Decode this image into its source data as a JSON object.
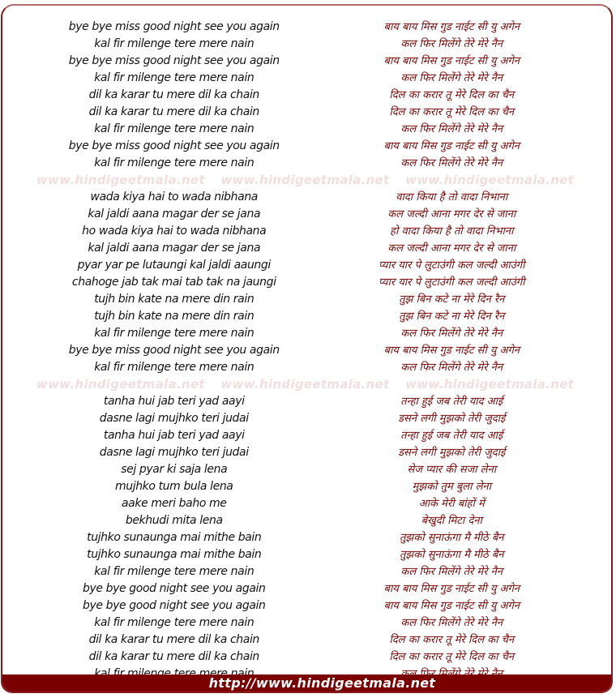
{
  "watermark_text": "www.hindigeetmala.net",
  "footer": {
    "url_text": "http://www.hindigeetmala.net"
  },
  "colors": {
    "accent": "#7a0000",
    "english_text": "#111111",
    "hindi_text": "#7a0a0a",
    "watermark": "#f1dede"
  },
  "stanzas": [
    {
      "lines": [
        {
          "en": "bye bye miss good night see you again",
          "hi": "बाय बाय मिस गुड नाईट सी यु अगेन"
        },
        {
          "en": "kal fir milenge tere mere nain",
          "hi": "कल फिर मिलेंगे तेरे मेरे नैन"
        },
        {
          "en": "bye bye miss good night see you again",
          "hi": "बाय बाय मिस गुड नाईट सी यु अगेन"
        },
        {
          "en": "kal fir milenge tere mere nain",
          "hi": "कल फिर मिलेंगे तेरे मेरे नैन"
        },
        {
          "en": "dil ka karar tu mere dil ka chain",
          "hi": "दिल का करार तू मेरे दिल का चैन"
        },
        {
          "en": "dil ka karar tu mere dil ka chain",
          "hi": "दिल का करार तू मेरे दिल का चैन"
        },
        {
          "en": "kal fir milenge tere mere nain",
          "hi": "कल फिर मिलेंगे तेरे मेरे नैन"
        },
        {
          "en": "bye bye miss good night see you again",
          "hi": "बाय बाय मिस गुड नाईट सी यु अगेन"
        },
        {
          "en": "kal fir milenge tere mere nain",
          "hi": "कल फिर मिलेंगे तेरे मेरे नैन"
        }
      ]
    },
    {
      "lines": [
        {
          "en": "wada kiya hai to wada nibhana",
          "hi": "वादा किया है तो वादा निभाना"
        },
        {
          "en": "kal jaldi aana magar der se jana",
          "hi": "कल जल्दी आना मगर देर से जाना"
        },
        {
          "en": "ho wada kiya hai to wada nibhana",
          "hi": "हो वादा किया है तो वादा निभाना"
        },
        {
          "en": "kal jaldi aana magar der se jana",
          "hi": "कल जल्दी आना मगर देर से जाना"
        },
        {
          "en": "pyar yar pe lutaungi kal jaldi aaungi",
          "hi": "प्यार यार पे लुटाउंगी कल जल्दी आउंगी"
        },
        {
          "en": "chahoge jab tak mai tab tak na jaungi",
          "hi": "प्यार यार पे लुटाउंगी कल जल्दी आउंगी"
        },
        {
          "en": "tujh bin kate na mere din rain",
          "hi": "तुझ बिन कटे ना मेरे दिन रैन"
        },
        {
          "en": "tujh bin kate na mere din rain",
          "hi": "तुझ बिन कटे ना मेरे दिन रैन"
        },
        {
          "en": "kal fir milenge tere mere nain",
          "hi": "कल फिर मिलेंगे तेरे मेरे नैन"
        },
        {
          "en": "bye bye miss good night see you again",
          "hi": "बाय बाय मिस गुड नाईट सी यु अगेन"
        },
        {
          "en": "kal fir milenge tere mere nain",
          "hi": "कल फिर मिलेंगे तेरे मेरे नैन"
        }
      ]
    },
    {
      "lines": [
        {
          "en": "tanha hui jab teri yad aayi",
          "hi": "तन्हा हुई जब तेरी याद आई"
        },
        {
          "en": "dasne lagi mujhko teri judai",
          "hi": "डसने लगी मुझको तेरी जुदाई"
        },
        {
          "en": "tanha hui jab teri yad aayi",
          "hi": "तन्हा हुई जब तेरी याद आई"
        },
        {
          "en": "dasne lagi mujhko teri judai",
          "hi": "डसने लगी मुझको तेरी जुदाई"
        },
        {
          "en": "sej pyar ki saja lena",
          "hi": "सेज प्यार की सजा लेना"
        },
        {
          "en": "mujhko tum bula lena",
          "hi": "मुझको तुम बुला लेना"
        },
        {
          "en": "aake meri baho me",
          "hi": "आके मेरी बांहों में"
        },
        {
          "en": "bekhudi mita lena",
          "hi": "बेखुदी मिटा देना"
        },
        {
          "en": "tujhko sunaunga mai mithe bain",
          "hi": "तुझको सुनाऊंगा मै मीठे बैन"
        },
        {
          "en": "tujhko sunaunga mai mithe bain",
          "hi": "तुझको सुनाऊंगा मै मीठे बैन"
        },
        {
          "en": "kal fir milenge tere mere nain",
          "hi": "कल फिर मिलेंगे तेरे मेरे नैन"
        },
        {
          "en": "bye bye good night see you again",
          "hi": "बाय बाय मिस गुड नाईट सी यु अगेन"
        },
        {
          "en": "bye bye good night see you again",
          "hi": "बाय बाय मिस गुड नाईट सी यु अगेन"
        },
        {
          "en": "kal fir milenge tere mere nain",
          "hi": "कल फिर मिलेंगे तेरे मेरे नैन"
        },
        {
          "en": "dil ka karar tu mere dil ka chain",
          "hi": "दिल का करार तू मेरे दिल का चैन"
        },
        {
          "en": "dil ka karar tu mere dil ka chain",
          "hi": "दिल का करार तू मेरे दिल का चैन"
        },
        {
          "en": "kal fir milenge tere mere nain",
          "hi": "कल फिर मिलेंगे तेरे मेरे नैन"
        }
      ]
    }
  ]
}
